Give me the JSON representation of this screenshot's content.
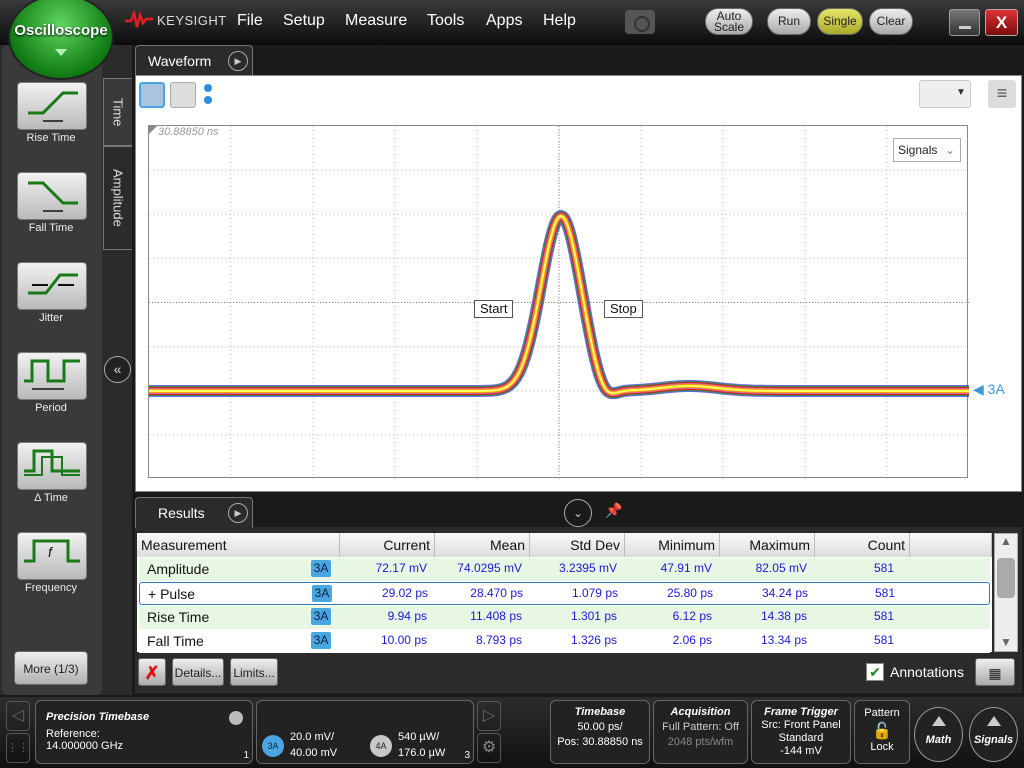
{
  "app": {
    "title": "Oscilloscope",
    "brand": "KEYSIGHT"
  },
  "menu": [
    "File",
    "Setup",
    "Measure",
    "Tools",
    "Apps",
    "Help"
  ],
  "toolbar": {
    "auto_scale": "Auto Scale",
    "run": "Run",
    "single": "Single",
    "clear": "Clear",
    "close": "X"
  },
  "measure_panel": {
    "buttons": [
      {
        "label": "Rise Time"
      },
      {
        "label": "Fall Time"
      },
      {
        "label": "Jitter"
      },
      {
        "label": "Period"
      },
      {
        "label": "Δ Time"
      },
      {
        "label": "Frequency"
      }
    ],
    "tabs": [
      "Time",
      "Amplitude"
    ],
    "more": "More (1/3)"
  },
  "waveform": {
    "tab": "Waveform",
    "timestamp": "30.88850 ns",
    "signals_dropdown": "Signals",
    "start_marker": "Start",
    "stop_marker": "Stop",
    "channel_label": "3A",
    "trace_colors": [
      "#2a2ad0",
      "#20a020",
      "#d02020",
      "#e060a0",
      "#f0a000",
      "#ffff60"
    ]
  },
  "results": {
    "tab": "Results",
    "columns": [
      "Measurement",
      "Current",
      "Mean",
      "Std Dev",
      "Minimum",
      "Maximum",
      "Count"
    ],
    "rows": [
      {
        "name": "Amplitude",
        "source": "3A",
        "current": "72.17 mV",
        "mean": "74.0295 mV",
        "std": "3.2395 mV",
        "min": "47.91 mV",
        "max": "82.05 mV",
        "count": "581"
      },
      {
        "name": "+ Pulse",
        "source": "3A",
        "current": "29.02 ps",
        "mean": "28.470 ps",
        "std": "1.079 ps",
        "min": "25.80 ps",
        "max": "34.24 ps",
        "count": "581"
      },
      {
        "name": "Rise Time",
        "source": "3A",
        "current": "9.94 ps",
        "mean": "11.408 ps",
        "std": "1.301 ps",
        "min": "6.12 ps",
        "max": "14.38 ps",
        "count": "581"
      },
      {
        "name": "Fall Time",
        "source": "3A",
        "current": "10.00 ps",
        "mean": "8.793 ps",
        "std": "1.326 ps",
        "min": "2.06 ps",
        "max": "13.34 ps",
        "count": "581"
      }
    ],
    "details": "Details...",
    "limits": "Limits...",
    "annotations": "Annotations",
    "annotations_checked": true
  },
  "status": {
    "precision": {
      "title": "Precision Timebase",
      "ref_label": "Reference:",
      "ref_value": "14.000000 GHz",
      "corner": "1"
    },
    "channels": [
      {
        "id": "3A",
        "scale": "20.0 mV/",
        "offset": "40.00 mV",
        "color": "#4aa6e0"
      },
      {
        "id": "4A",
        "scale": "540 µW/",
        "offset": "176.0 µW",
        "color": "#c8c8c8"
      }
    ],
    "channels_corner": "3",
    "timebase": {
      "title": "Timebase",
      "scale": "50.00 ps/",
      "pos": "Pos: 30.88850 ns"
    },
    "acquisition": {
      "title": "Acquisition",
      "line1": "Full Pattern: Off",
      "line2": "2048 pts/wfm"
    },
    "trigger": {
      "title": "Frame Trigger",
      "src": "Src: Front Panel",
      "mode": "Standard",
      "level": "-144 mV"
    },
    "pattern": {
      "title": "Pattern",
      "lock": "Lock"
    },
    "math": "Math",
    "signals": "Signals"
  }
}
